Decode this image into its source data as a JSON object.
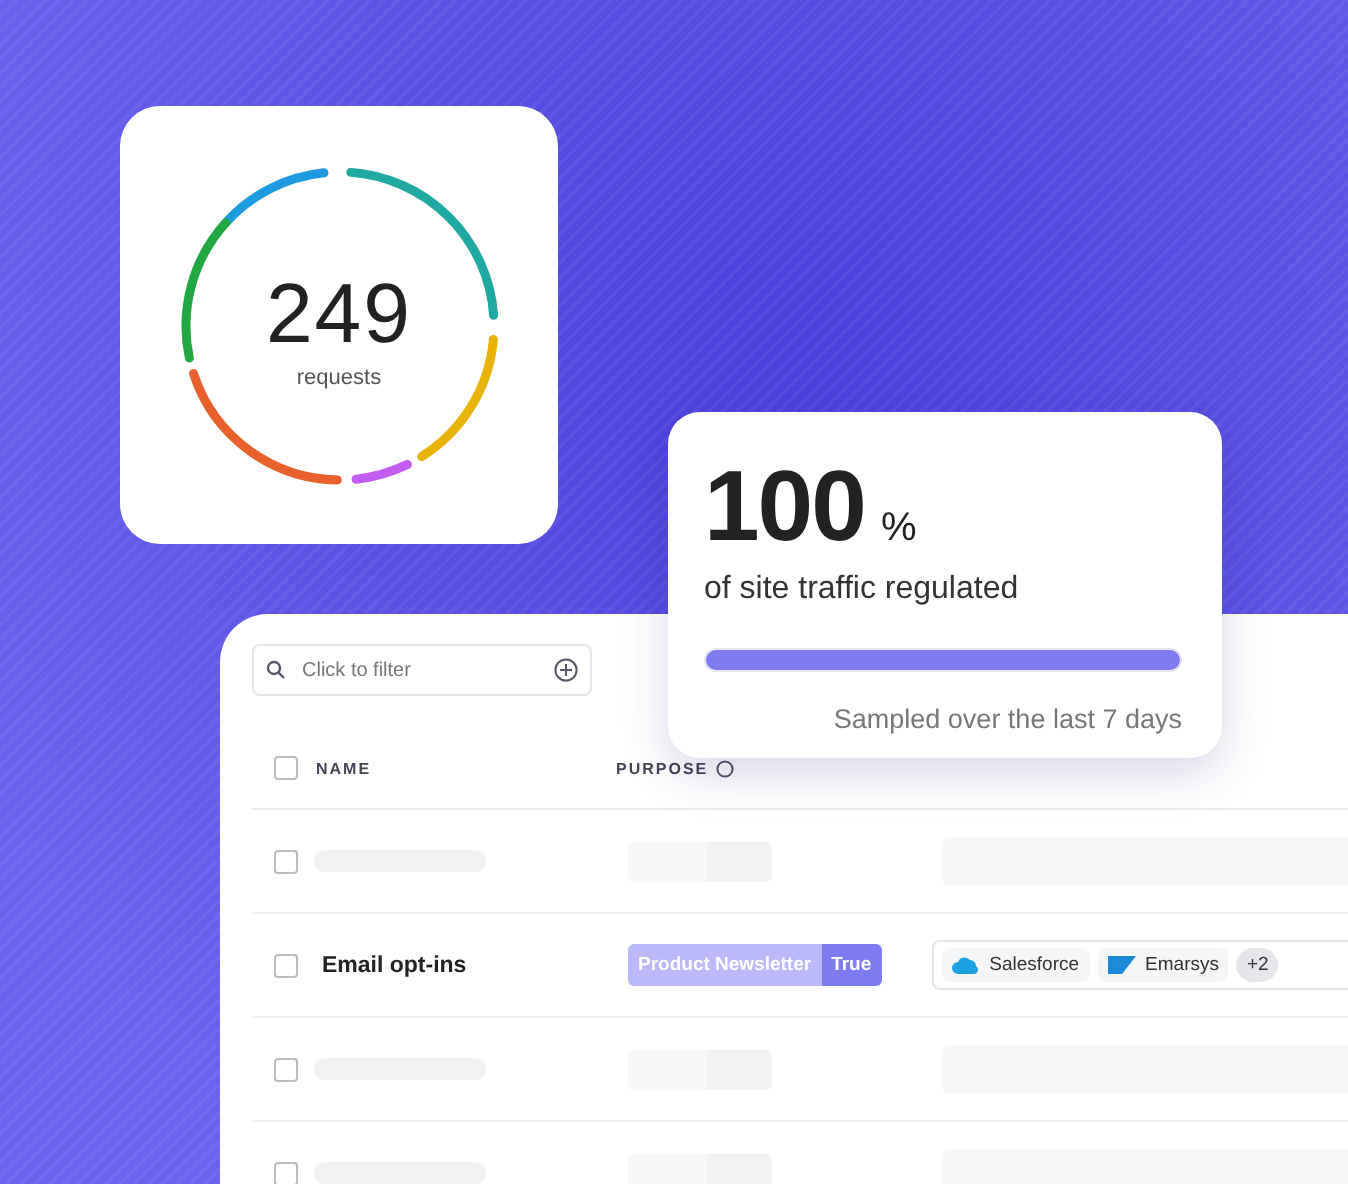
{
  "requests_card": {
    "count": "249",
    "label": "requests"
  },
  "traffic_card": {
    "value": "100",
    "unit": "%",
    "caption": "of site traffic regulated",
    "level": 1,
    "note": "Sampled over the last 7 days"
  },
  "table": {
    "filter": {
      "placeholder": "Click to filter"
    },
    "header_checked": false,
    "columns": [
      {
        "label": "NAME"
      },
      {
        "label": "PURPOSE"
      }
    ],
    "rows": [
      {
        "kind": "placeholder",
        "checked": false
      },
      {
        "kind": "record",
        "checked": false,
        "name": "Email opt-ins",
        "purpose": {
          "label": "Product Newsletter",
          "value": "True"
        },
        "integrations": [
          {
            "kind": "cloud",
            "name": "Salesforce"
          },
          {
            "kind": "flag",
            "name": "Emarsys"
          }
        ],
        "more": "+2"
      },
      {
        "kind": "placeholder",
        "checked": false
      },
      {
        "kind": "placeholder",
        "checked": false
      }
    ]
  }
}
